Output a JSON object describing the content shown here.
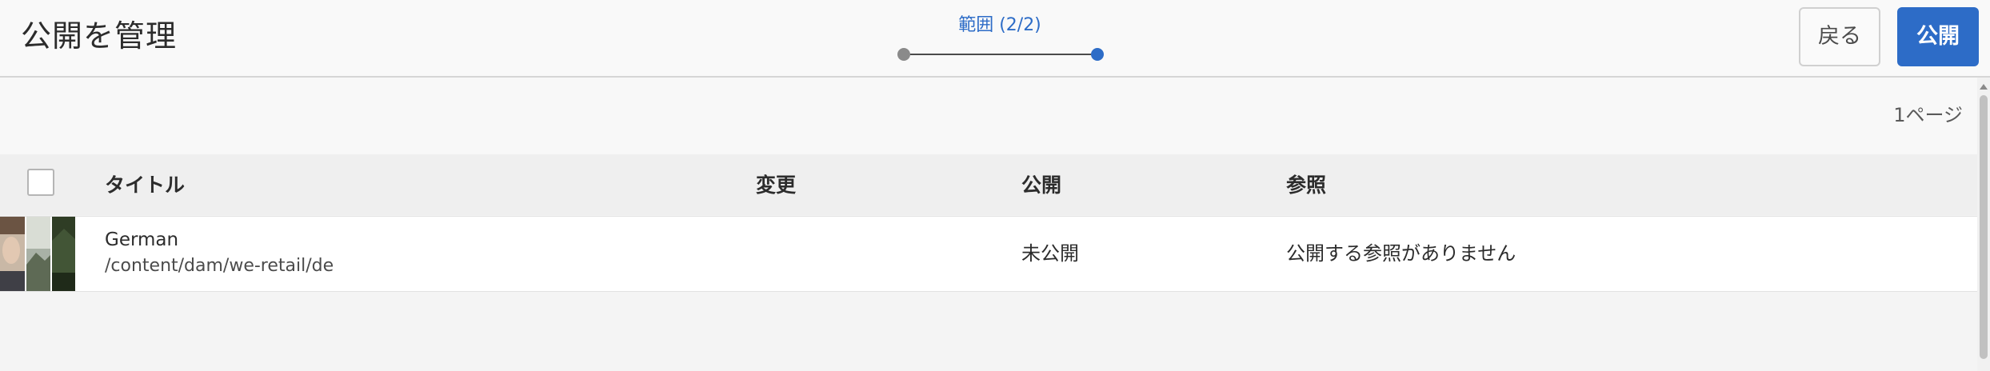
{
  "header": {
    "title": "公開を管理",
    "wizard": {
      "step_label": "範囲 (2/2)",
      "current_step": 2,
      "total_steps": 2
    },
    "back_label": "戻る",
    "publish_label": "公開"
  },
  "content": {
    "page_count": "1ページ",
    "columns": {
      "title": "タイトル",
      "modified": "変更",
      "published": "公開",
      "references": "参照"
    },
    "rows": [
      {
        "title": "German",
        "path": "/content/dam/we-retail/de",
        "modified": "",
        "published": "未公開",
        "references": "公開する参照がありません"
      }
    ]
  },
  "colors": {
    "accent": "#2d6cc7",
    "header_bg": "#f9f9f9",
    "content_bg": "#f4f4f4",
    "row_bg": "#ffffff",
    "text": "#2c2c2c"
  },
  "icons": {
    "row_thumbnail": "folder-image-collage-thumbnail"
  }
}
